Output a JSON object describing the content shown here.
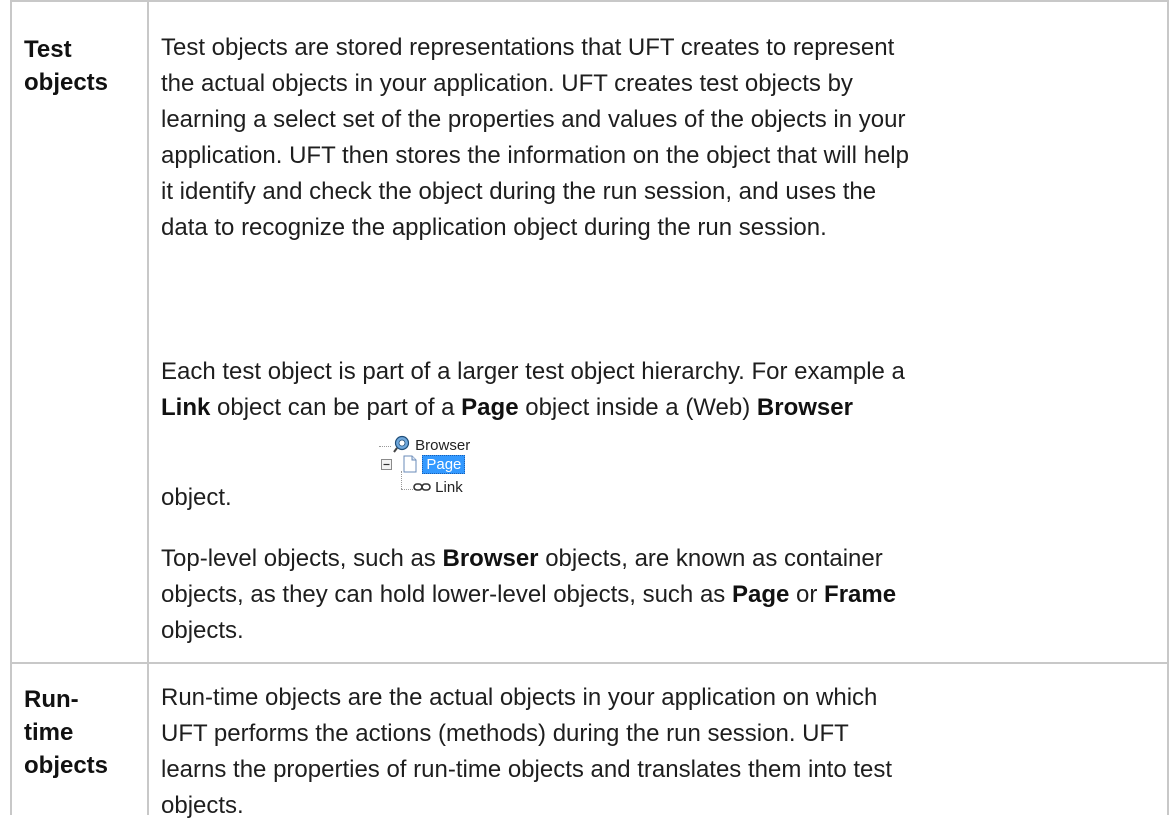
{
  "rows": [
    {
      "term_lines": [
        "Test",
        "objects"
      ],
      "paragraphs": {
        "p1": [
          "Test objects are stored representations that UFT creates to represent",
          "the actual objects in your application. UFT creates test objects by",
          "learning a select set of the properties and values of the objects in your",
          "application. UFT then stores the information on the object that will help",
          "it identify and check the object during the run session, and uses the",
          "data to recognize the application object during the run session."
        ],
        "p2": {
          "line1": "Each test object is part of a larger test object hierarchy. For example a",
          "line2_bold1": "Link",
          "line2_t1": " object can be part of a ",
          "line2_bold2": "Page",
          "line2_t2": " object inside a (Web) ",
          "line2_bold3": "Browser",
          "line3": "object."
        },
        "p3": {
          "line1_bold": "Browser",
          "line1_t1": "Top-level objects, such as ",
          "line1_t2": " objects, are known as container",
          "line2_t1": "objects, as they can hold lower-level objects, such as ",
          "line2_bold1": "Page",
          "line2_t2": " or ",
          "line2_bold2": "Frame",
          "line3": "objects."
        }
      },
      "hierarchy": {
        "browser_label": "Browser",
        "page_label": "Page",
        "link_label": "Link"
      }
    },
    {
      "term_lines": [
        "Run-",
        "time",
        "objects"
      ],
      "paragraphs": {
        "p1": [
          "Run-time objects are the actual objects in your application on which",
          "UFT performs the actions (methods) during the run session. UFT",
          "learns the properties of run-time objects and translates them into test",
          "objects."
        ]
      }
    }
  ],
  "colors": {
    "border": "#c8c8c8",
    "text": "#1e1e1e",
    "selection": "#3399ff"
  }
}
